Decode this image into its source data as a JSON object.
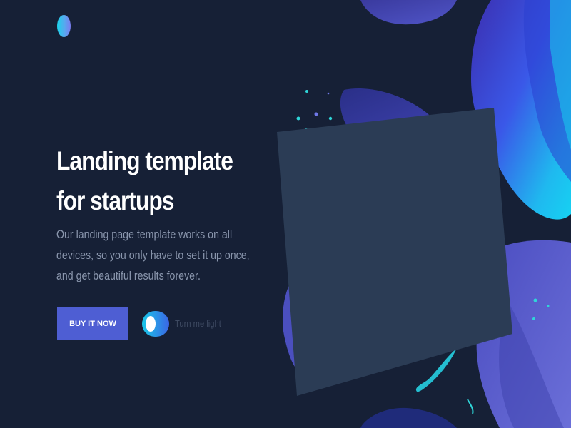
{
  "header": {
    "logo_icon": "gradient-oval-logo"
  },
  "hero": {
    "title": "Landing template for startups",
    "description": "Our landing page template works on all devices, so you only have to set it up once, and get beautiful results forever.",
    "cta_label": "BUY IT NOW",
    "toggle_label": "Turn me light",
    "toggle_state": "on"
  },
  "colors": {
    "background": "#162036",
    "panel": "#2b3c55",
    "accent": "#4e5ed3",
    "cyan": "#18c8e8",
    "muted_text": "#8a96ad"
  }
}
